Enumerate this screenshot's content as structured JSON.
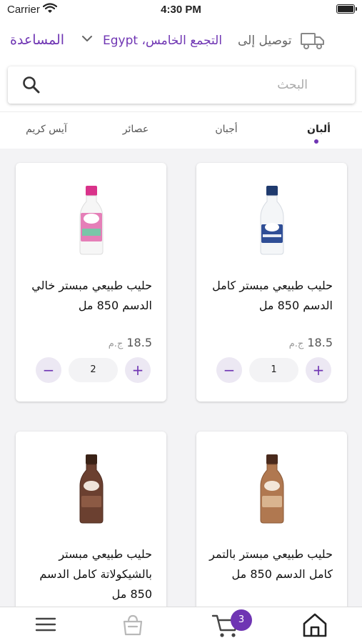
{
  "status_bar": {
    "carrier": "Carrier",
    "time": "4:30 PM"
  },
  "header": {
    "help_label": "المساعدة",
    "delivery_label": "توصيل إلى",
    "delivery_location": "التجمع الخامس، Egypt"
  },
  "search": {
    "placeholder": "البحث",
    "value": ""
  },
  "tabs": [
    {
      "label": "ألبان",
      "active": true
    },
    {
      "label": "أجبان",
      "active": false
    },
    {
      "label": "عصائر",
      "active": false
    },
    {
      "label": "آيس كريم",
      "active": false
    }
  ],
  "products": [
    {
      "title": "حليب طبيعي مبستر كامل الدسم 850 مل",
      "price": "18.5",
      "currency": "ج.م",
      "quantity": "1",
      "cap_color": "#1f3a6e",
      "label_color": "#2f4e96"
    },
    {
      "title": "حليب طبيعي مبستر خالي الدسم 850 مل",
      "price": "18.5",
      "currency": "ج.م",
      "quantity": "2",
      "cap_color": "#d9328a",
      "label_color": "#e57fb8"
    },
    {
      "title": "حليب طبيعي مبستر بالتمر كامل الدسم 850 مل",
      "price": "",
      "currency": "",
      "quantity": "",
      "cap_color": "#4a2a1c",
      "label_color": "#b07850"
    },
    {
      "title": "حليب طبيعي مبستر بالشيكولاتة كامل الدسم 850 مل",
      "price": "",
      "currency": "",
      "quantity": "",
      "cap_color": "#3a2216",
      "label_color": "#6b4030"
    }
  ],
  "qty_controls": {
    "minus": "−",
    "plus": "+"
  },
  "bottom_nav": {
    "cart_count": "3"
  },
  "colors": {
    "accent": "#6f35b3",
    "accent_light": "#ece8f3"
  }
}
